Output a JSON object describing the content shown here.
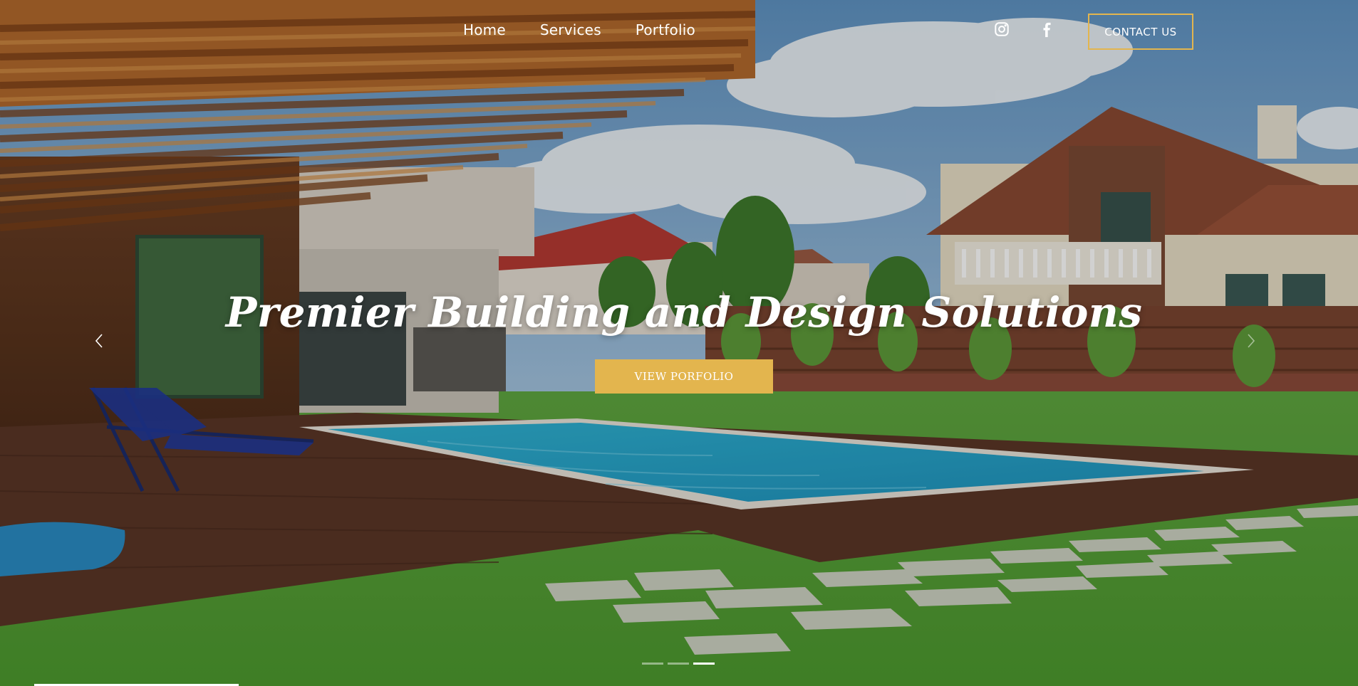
{
  "nav": {
    "items": [
      {
        "label": "Home"
      },
      {
        "label": "Services"
      },
      {
        "label": "Portfolio"
      }
    ]
  },
  "social": {
    "instagram_icon": "instagram-icon",
    "facebook_icon": "facebook-icon"
  },
  "header": {
    "contact_label": "CONTACT US"
  },
  "hero": {
    "headline": "Premier Building and Design Solutions",
    "cta_label": "VIEW PORFOLIO",
    "slide_count": 3,
    "active_slide": 3
  },
  "colors": {
    "accent": "#e3b54e",
    "text": "#ffffff"
  }
}
